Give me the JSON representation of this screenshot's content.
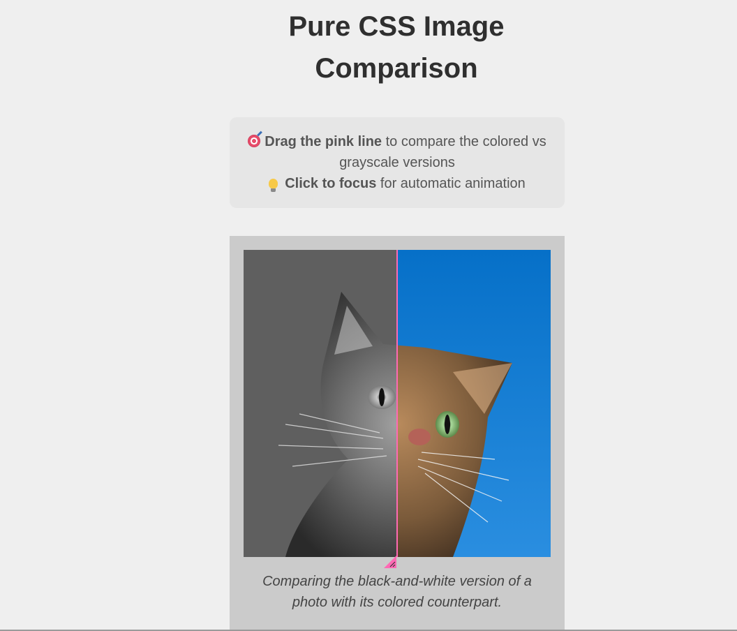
{
  "page": {
    "title": "Pure CSS Image Comparison"
  },
  "hint": {
    "line1_bold": "Drag the pink line",
    "line1_rest": " to compare the colored vs grayscale versions",
    "line2_bold": "Click to focus",
    "line2_rest": " for automatic animation",
    "icon1": "direct-hit-icon",
    "icon2": "light-bulb-icon"
  },
  "comparison": {
    "left_version": "grayscale",
    "right_version": "colored",
    "divider_position": 0.5,
    "divider_color": "#ff69b4",
    "sky_color": "#0a78d0",
    "gray_bg": "#5f5f5f"
  },
  "caption": "Comparing the black-and-white version of a photo with its colored counterpart."
}
